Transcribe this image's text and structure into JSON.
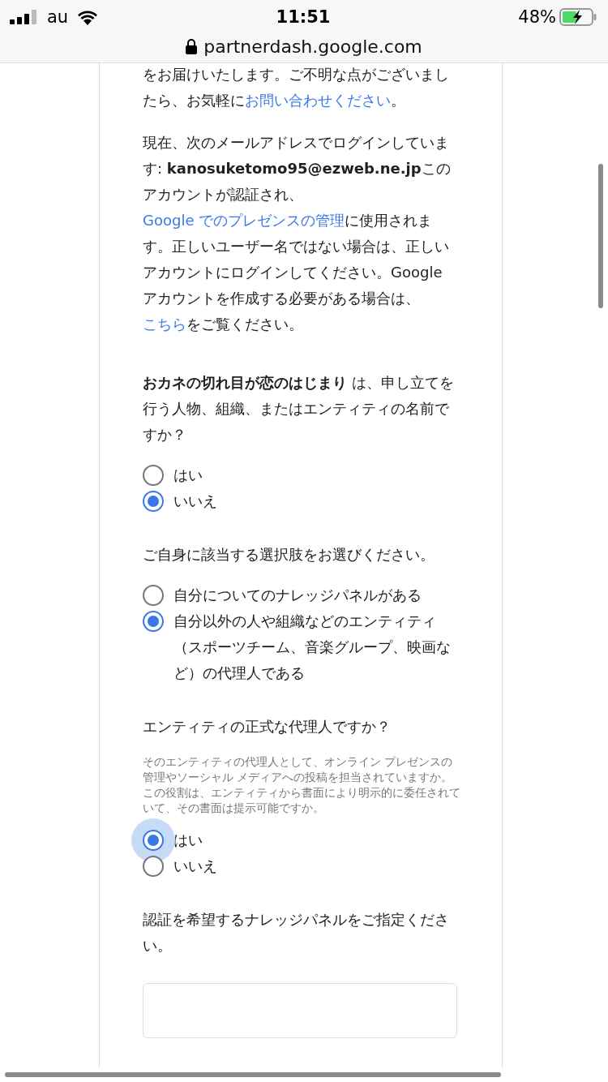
{
  "status_bar": {
    "carrier": "au",
    "time": "11:51",
    "battery": "48%"
  },
  "address_bar": {
    "url": "partnerdash.google.com"
  },
  "paragraphs": [
    [
      {
        "kind": "text",
        "text": "をお届けいたします。ご不明な点がございましたら、お気軽に"
      },
      {
        "kind": "link",
        "text": "お問い合わせください"
      },
      {
        "kind": "text",
        "text": "。"
      }
    ],
    [
      {
        "kind": "text",
        "text": "現在、次のメールアドレスでログインしています: "
      },
      {
        "kind": "bold",
        "text": "kanosuketomo95@ezweb.ne.jp"
      },
      {
        "kind": "text",
        "text": "このアカウントが認証され、"
      },
      {
        "kind": "link",
        "text": "Google でのプレゼンスの管理"
      },
      {
        "kind": "text",
        "text": "に使用されます。正しいユーザー名ではない場合は、正しいアカウントにログインしてください。Google アカウントを作成する必要がある場合は、"
      },
      {
        "kind": "link",
        "text": "こちら"
      },
      {
        "kind": "text",
        "text": "をご覧ください。"
      }
    ]
  ],
  "questions": [
    {
      "question": "**おカネの切れ目が恋のはじまり** は、申し立てを行う人物、組織、またはエンティティの名前ですか？",
      "options": [
        {
          "label": "はい",
          "selected": false,
          "focused": false
        },
        {
          "label": "いいえ",
          "selected": true,
          "focused": false
        }
      ]
    },
    {
      "question": "ご自身に該当する選択肢をお選びください。",
      "options": [
        {
          "label": "自分についてのナレッジパネルがある",
          "selected": false,
          "focused": false
        },
        {
          "label": "自分以外の人や組織などのエンティティ（スポーツチーム、音楽グループ、映画など）の代理人である",
          "selected": true,
          "focused": false
        }
      ]
    },
    {
      "question": "エンティティの正式な代理人ですか？",
      "help": "そのエンティティの代理人として、オンライン プレゼンスの管理やソーシャル メディアへの投稿を担当されていますか。この役割は、エンティティから書面により明示的に委任されていて、その書面は提示可能ですか。",
      "options": [
        {
          "label": "はい",
          "selected": true,
          "focused": true
        },
        {
          "label": "いいえ",
          "selected": false,
          "focused": false
        }
      ]
    }
  ],
  "final_question": {
    "question": "認証を希望するナレッジパネルをご指定ください。"
  }
}
